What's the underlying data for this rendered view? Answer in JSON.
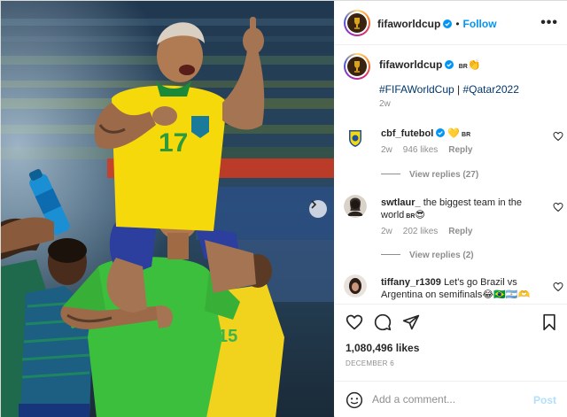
{
  "header": {
    "username": "fifaworldcup",
    "follow_label": "Follow",
    "separator": "•",
    "more_label": "•••"
  },
  "caption": {
    "username": "fifaworldcup",
    "flag_text": "BR",
    "clap_emoji": "👏",
    "hashtag_1": "#FIFAWorldCup",
    "hashtag_sep": " | ",
    "hashtag_2": "#Qatar2022",
    "time": "2w"
  },
  "comments": [
    {
      "username": "cbf_futebol",
      "text": "",
      "heart_emoji": "💛",
      "flag_text": "BR",
      "time": "2w",
      "likes": "946 likes",
      "reply_label": "Reply",
      "view_replies": "View replies (27)"
    },
    {
      "username": "swtlaur_",
      "text": "the biggest team in the world",
      "flag_text": "BR",
      "emoji": "😎",
      "time": "2w",
      "likes": "202 likes",
      "reply_label": "Reply",
      "view_replies": "View replies (2)"
    },
    {
      "username": "tiffany_r1309",
      "text": "Let's go Brazil vs Argentina on semifinals",
      "emoji": "😂🇧🇷🇦🇷🫶",
      "time": "",
      "likes": "",
      "reply_label": ""
    }
  ],
  "post": {
    "likes": "1,080,496 likes",
    "date": "DECEMBER 6"
  },
  "composer": {
    "placeholder": "Add a comment...",
    "post_label": "Post"
  },
  "icons": {
    "heart": "heart-icon",
    "comment": "comment-icon",
    "share": "share-icon",
    "save": "bookmark-icon",
    "emoji": "emoji-icon",
    "verified": "verified-badge-icon",
    "carousel_next": "chevron-right-icon"
  },
  "colors": {
    "accent_blue": "#0095f6",
    "hashtag_blue": "#00376b",
    "muted": "#8e8e8e",
    "brazil_yellow": "#f5d90a",
    "keeper_green": "#3cbf3c"
  }
}
